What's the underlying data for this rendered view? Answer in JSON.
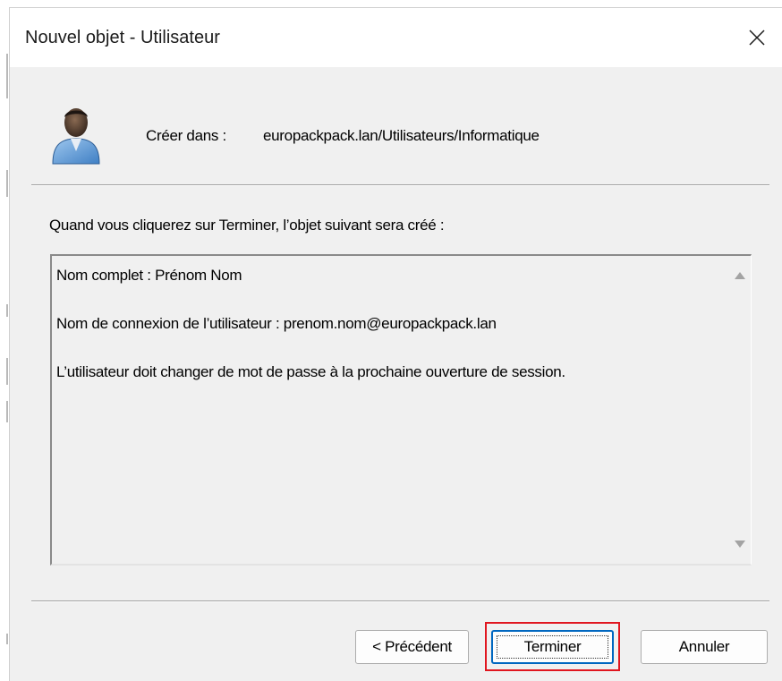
{
  "window": {
    "title": "Nouvel objet - Utilisateur",
    "close_glyph": "✕"
  },
  "header": {
    "icon": "user-icon",
    "create_label": "Créer dans :",
    "create_path": "europackpack.lan/Utilisateurs/Informatique"
  },
  "intro_text": "Quand vous cliquerez sur Terminer, l’objet suivant sera créé :",
  "summary": {
    "lines": [
      "Nom complet : Prénom Nom",
      "Nom de connexion de l’utilisateur : prenom.nom@europackpack.lan",
      "L’utilisateur doit changer de mot de passe à la prochaine ouverture de session."
    ]
  },
  "buttons": {
    "previous": "< Précédent",
    "finish": "Terminer",
    "cancel": "Annuler"
  },
  "colors": {
    "highlight": "#e0161f",
    "focus_border": "#0067c0",
    "dialog_bg": "#f0f0f0"
  }
}
